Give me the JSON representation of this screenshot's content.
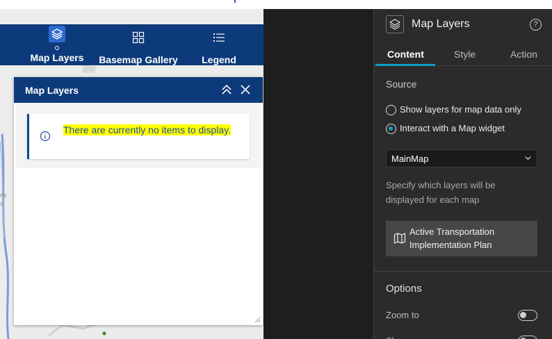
{
  "header": {
    "items": [
      {
        "label": "Map Layers",
        "icon": "layers-icon",
        "active": true
      },
      {
        "label": "Basemap Gallery",
        "icon": "basemap-grid-icon",
        "active": false
      },
      {
        "label": "Legend",
        "icon": "legend-list-icon",
        "active": false
      }
    ]
  },
  "panel": {
    "title": "Map Layers",
    "message": "There are currently no items to display."
  },
  "map": {
    "fragments": [
      "ns",
      "s"
    ]
  },
  "settings": {
    "title": "Map Layers",
    "help": "?",
    "tabs": [
      "Content",
      "Style",
      "Action"
    ],
    "source_label": "Source",
    "radio_option_1": "Show layers for map data only",
    "radio_option_2": "Interact with a Map widget",
    "selected_map": "MainMap",
    "hint": "Specify which layers will be displayed for each map",
    "map_item": "Active Transportation Implementation Plan",
    "options_label": "Options",
    "zoom_label": "Zoom to",
    "cut_label": "Sh"
  },
  "colors": {
    "header_blue": "#0d3a7a",
    "accent_cyan": "#0aa0c8",
    "highlight_yellow": "#ffff00",
    "panel_dark": "#2b2b2b"
  }
}
